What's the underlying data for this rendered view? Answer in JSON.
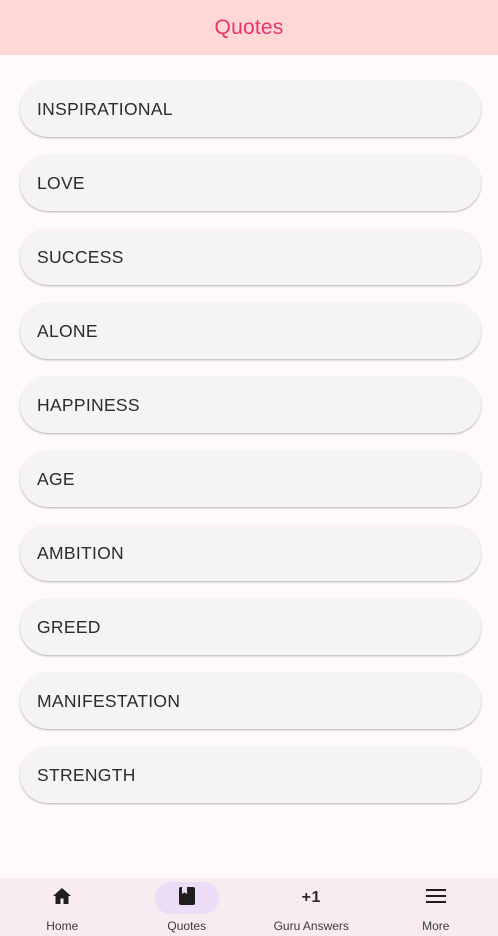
{
  "app_bar": {
    "title": "Quotes"
  },
  "categories": [
    {
      "label": "INSPIRATIONAL"
    },
    {
      "label": "LOVE"
    },
    {
      "label": "SUCCESS"
    },
    {
      "label": "ALONE"
    },
    {
      "label": "HAPPINESS"
    },
    {
      "label": "AGE"
    },
    {
      "label": "AMBITION"
    },
    {
      "label": "GREED"
    },
    {
      "label": "MANIFESTATION"
    },
    {
      "label": "STRENGTH"
    }
  ],
  "bottom_nav": {
    "items": [
      {
        "label": "Home",
        "icon": "home-icon"
      },
      {
        "label": "Quotes",
        "icon": "book-icon",
        "active": true
      },
      {
        "label": "Guru Answers",
        "icon": "plus-one-icon",
        "icon_text": "+1"
      },
      {
        "label": "More",
        "icon": "menu-icon"
      }
    ]
  },
  "colors": {
    "app_bar_bg": "#ffd8d6",
    "title": "#e8336f",
    "active_indicator": "#ebdcf7"
  }
}
